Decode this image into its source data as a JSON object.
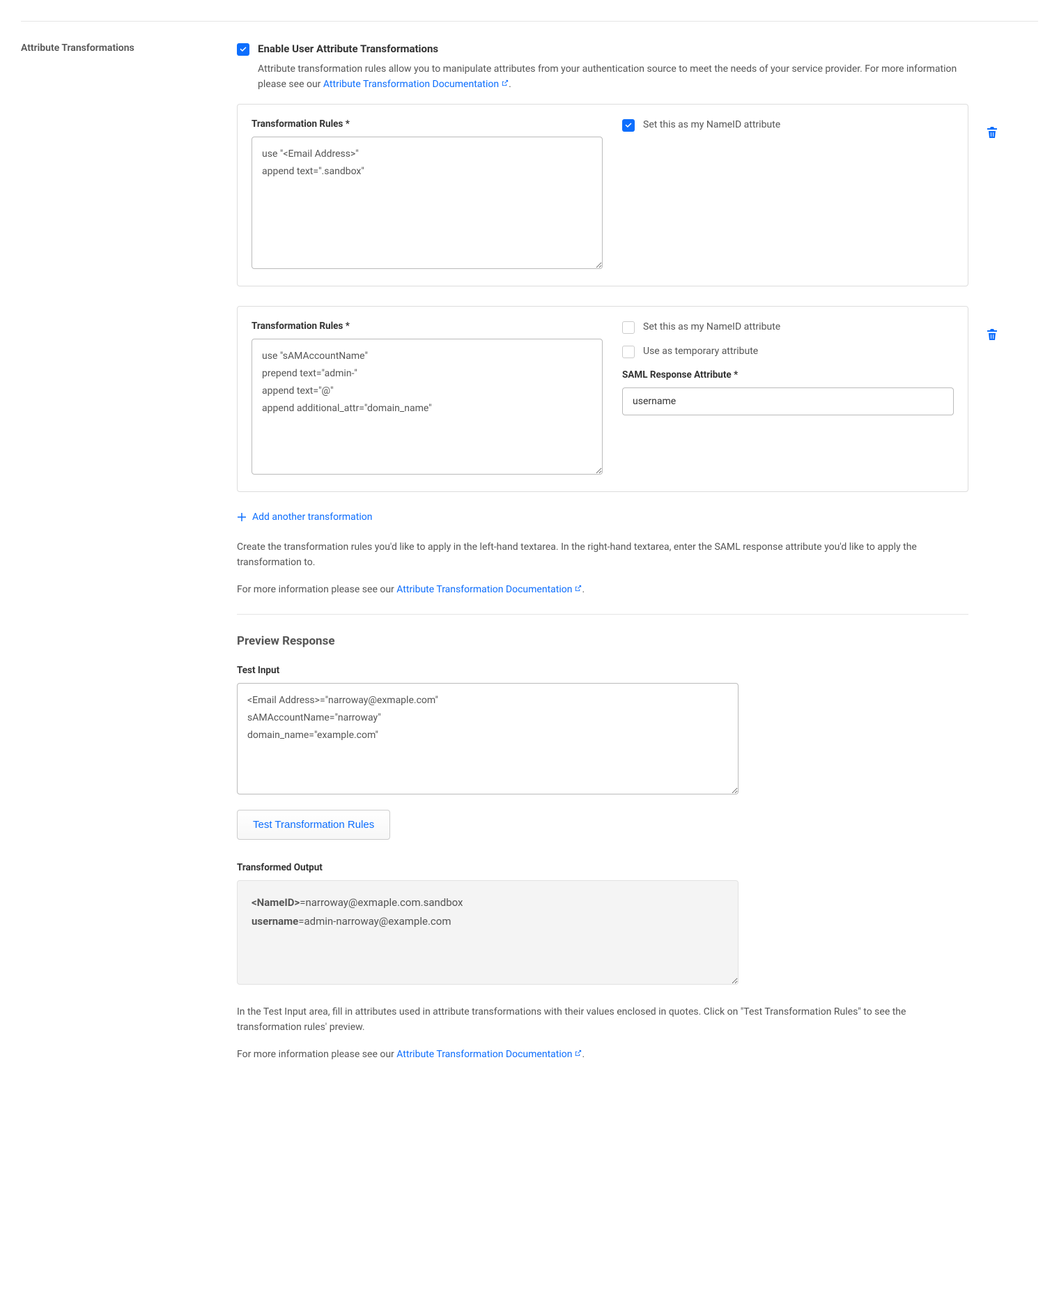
{
  "section": {
    "title": "Attribute Transformations"
  },
  "enable": {
    "label": "Enable User Attribute Transformations",
    "checked": true,
    "description_pre": "Attribute transformation rules allow you to manipulate attributes from your authentication source to meet the needs of your service provider. For more information please see our ",
    "doc_link": "Attribute Transformation Documentation",
    "description_post": "."
  },
  "rules": [
    {
      "label": "Transformation Rules *",
      "value": "use \"<Email Address>\"\nappend text=\".sandbox\"",
      "nameid": {
        "checked": true,
        "label": "Set this as my NameID attribute"
      }
    },
    {
      "label": "Transformation Rules *",
      "value": "use \"sAMAccountName\"\nprepend text=\"admin-\"\nappend text=\"@\"\nappend additional_attr=\"domain_name\"",
      "nameid": {
        "checked": false,
        "label": "Set this as my NameID attribute"
      },
      "temp_attr": {
        "checked": false,
        "label": "Use as temporary attribute"
      },
      "response_attr": {
        "label": "SAML Response Attribute *",
        "value": "username"
      }
    }
  ],
  "add_link": "Add another transformation",
  "instructions": {
    "text": "Create the transformation rules you'd like to apply in the left-hand textarea. In the right-hand textarea, enter the SAML response attribute you'd like to apply the transformation to.",
    "more_pre": "For more information please see our ",
    "doc_link": "Attribute Transformation Documentation",
    "more_post": "."
  },
  "preview": {
    "heading": "Preview Response",
    "test_input_label": "Test Input",
    "test_input_value": "<Email Address>=\"narroway@exmaple.com\"\nsAMAccountName=\"narroway\"\ndomain_name=\"example.com\"",
    "test_button": "Test Transformation Rules",
    "output_label": "Transformed Output",
    "output": [
      {
        "key": "<NameID>",
        "value": "=narroway@exmaple.com.sandbox"
      },
      {
        "key": "username",
        "value": "=admin-narroway@example.com"
      }
    ],
    "help": "In the Test Input area, fill in attributes used in attribute transformations with their values enclosed in quotes. Click on \"Test Transformation Rules\" to see the transformation rules' preview.",
    "more_pre": "For more information please see our ",
    "doc_link": "Attribute Transformation Documentation",
    "more_post": "."
  }
}
